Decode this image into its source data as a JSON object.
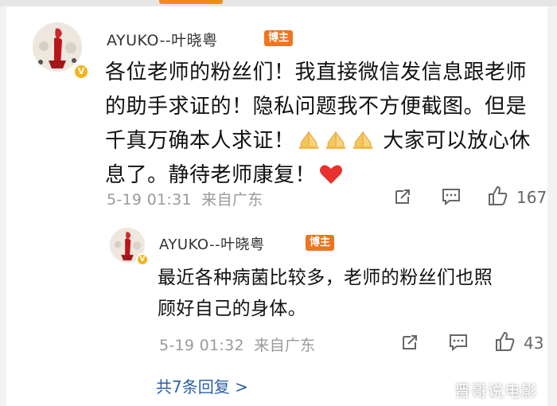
{
  "comment": {
    "username": "AYUKO--叶晓粤",
    "badge": "博主",
    "text_line1": "各位老师的粉丝们！我直接微信发信息跟老师",
    "text_line2": "的助手求证的！隐私问题我不方便截图。但是",
    "text_line3_a": "千真万确本人求证！",
    "text_line3_b": "大家可以放心休",
    "text_line4": "息了。静待老师康复！",
    "time": "5-19 01:31",
    "location": "来自广东",
    "likes": "167"
  },
  "reply": {
    "username": "AYUKO--叶晓粤",
    "badge": "博主",
    "text_line1": "最近各种病菌比较多，老师的粉丝们也照",
    "text_line2": "顾好自己的身体。",
    "time": "5-19 01:32",
    "location": "来自广东",
    "likes": "43"
  },
  "replies_link": "共7条回复 >",
  "watermark": "晋哥说电影",
  "colors": {
    "badge_bg": "#f0741f",
    "link": "#2a5fa8",
    "meta": "#9a9a9a",
    "verified": "#f3b31a",
    "heart": "#e8312f"
  }
}
